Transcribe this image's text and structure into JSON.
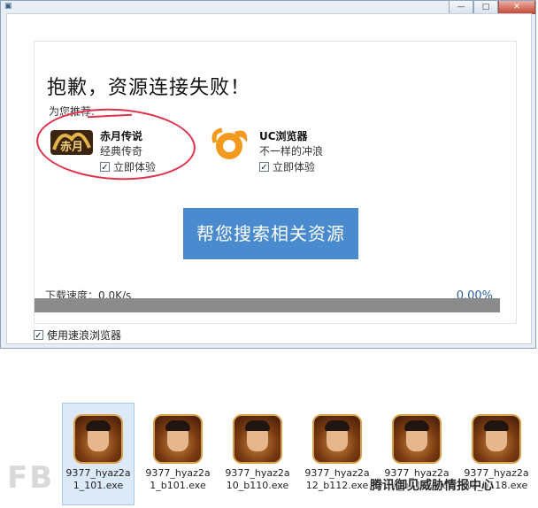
{
  "window": {
    "title_icon": "app-icon",
    "buttons": {
      "minimize": "—",
      "maximize": "□",
      "close": "✕"
    }
  },
  "dialog": {
    "headline": "抱歉，资源连接失败！",
    "recommend_label": "为您推荐:",
    "apps": [
      {
        "name": "赤月传说",
        "desc": "经典传奇",
        "check_label": "立即体验",
        "checked": true,
        "logo_text": "赤月"
      },
      {
        "name": "UC浏览器",
        "desc": "不一样的冲浪",
        "check_label": "立即体验",
        "checked": true
      }
    ],
    "search_button": "帮您搜索相关资源",
    "speed_text": "下载速度：0.0K/s",
    "percent_text": "0.00%",
    "progress": 0.0,
    "footer_check_label": "使用速浪浏览器",
    "footer_checked": true
  },
  "files": [
    {
      "name": "9377_hyaz2a1_101.exe",
      "selected": true
    },
    {
      "name": "9377_hyaz2a1_b101.exe",
      "selected": false
    },
    {
      "name": "9377_hyaz2a10_b110.exe",
      "selected": false
    },
    {
      "name": "9377_hyaz2a12_b112.exe",
      "selected": false
    },
    {
      "name": "9377_hyaz2a14_b114.exe",
      "selected": false
    },
    {
      "name": "9377_hyaz2a18_b118.exe",
      "selected": false
    }
  ],
  "watermark": "腾讯御见威胁情报中心",
  "colors": {
    "accent": "#4a8bd0",
    "annotation": "#e0304a",
    "uc_orange": "#f39a1e"
  }
}
